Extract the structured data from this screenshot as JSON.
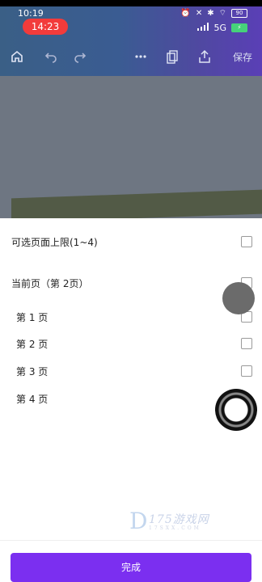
{
  "status": {
    "time": "10:19",
    "call_time": "14:23",
    "signal_label": "5G",
    "battery_top": "90",
    "battery_bottom": "⚡"
  },
  "toolbar": {
    "save_label": "保存"
  },
  "options": {
    "max_pages_label": "可选页面上限(1~4)",
    "current_page_label": "当前页（第 2页）",
    "pages": [
      {
        "label": "第 1 页"
      },
      {
        "label": "第 2 页"
      },
      {
        "label": "第 3 页"
      },
      {
        "label": "第 4 页"
      }
    ]
  },
  "watermark": {
    "text": "175游戏网",
    "sub": "17SXX.COM"
  },
  "footer": {
    "done_label": "完成"
  },
  "colors": {
    "accent": "#7b2ff0",
    "toolbar_gradient_start": "#3a5f86",
    "toolbar_gradient_end": "#5a3fb6",
    "call_pill": "#f23b3b"
  }
}
